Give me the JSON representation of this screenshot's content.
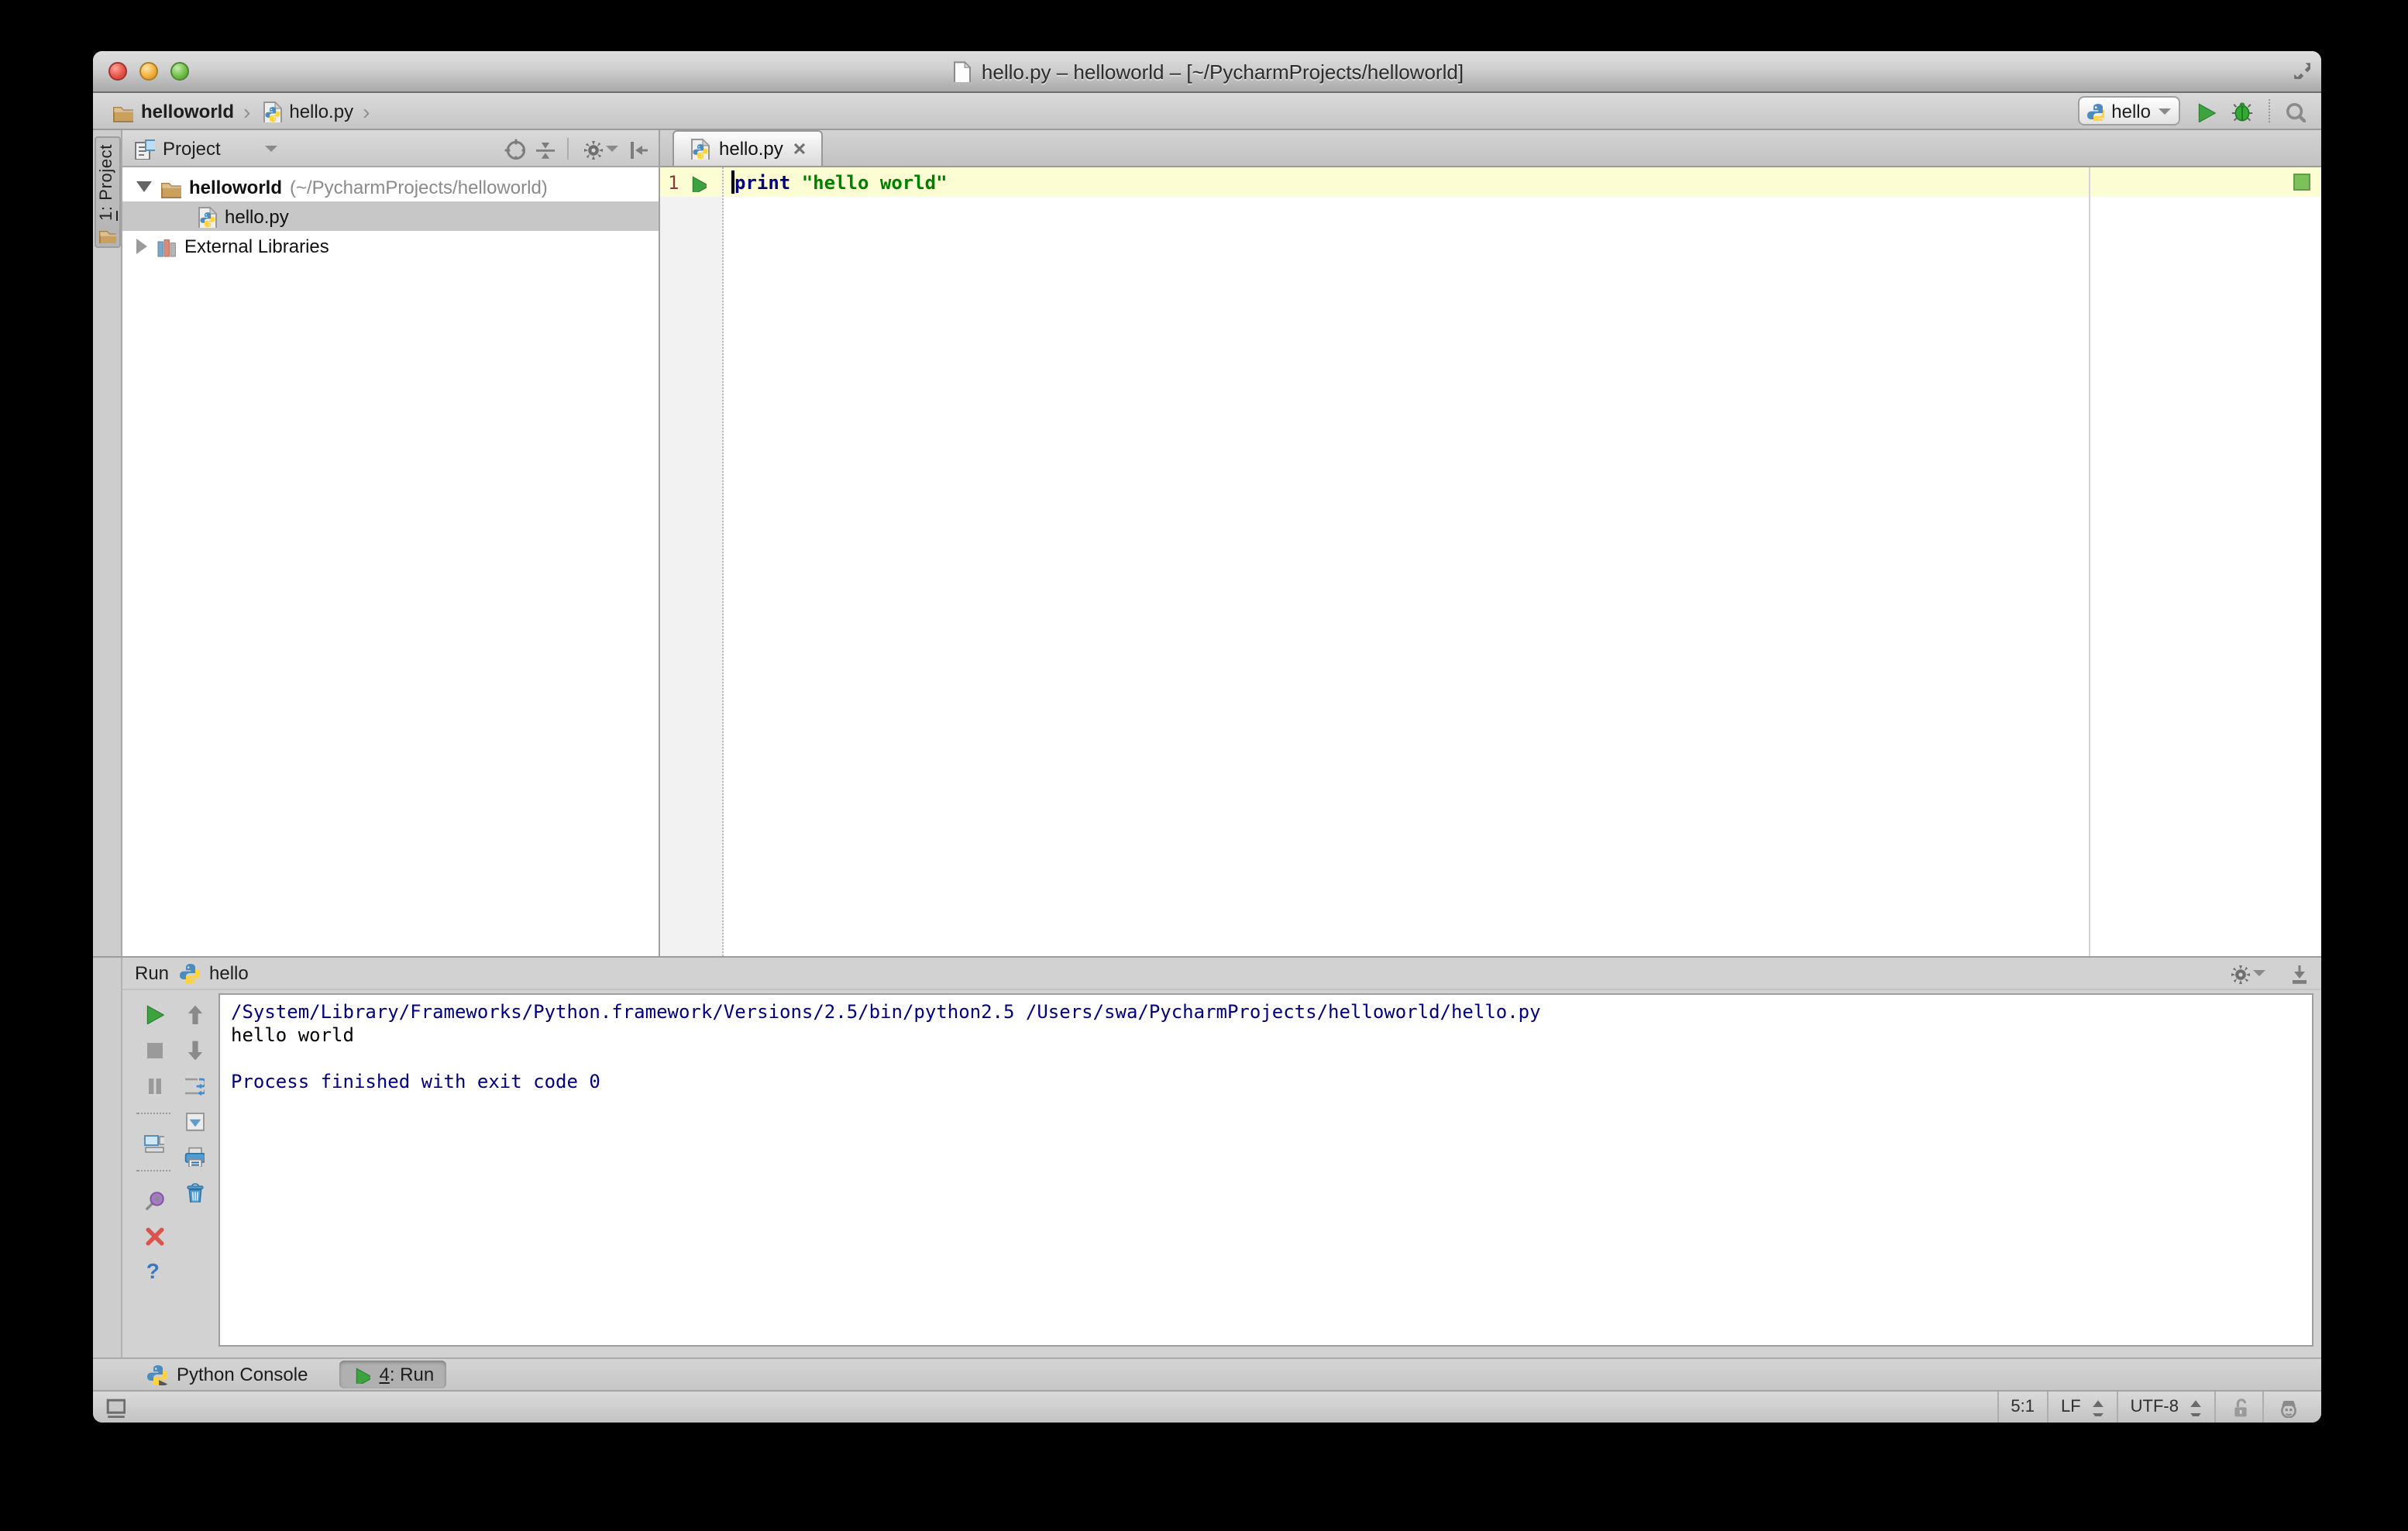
{
  "window": {
    "title": "hello.py – helloworld – [~/PycharmProjects/helloworld]"
  },
  "navbar": {
    "breadcrumbs": [
      "helloworld",
      "hello.py"
    ],
    "separator": "›",
    "run_config": {
      "label": "hello"
    }
  },
  "left_stripe": {
    "project_button": {
      "mnemonic": "1",
      "rest": ": Project"
    }
  },
  "project_panel": {
    "title": "Project",
    "tree": {
      "root_name": "helloworld",
      "root_path": "(~/PycharmProjects/helloworld)",
      "file": "hello.py",
      "external_libraries": "External Libraries"
    }
  },
  "editor": {
    "tab": {
      "label": "hello.py",
      "close_glyph": "✕"
    },
    "gutter": {
      "line_number": "1"
    },
    "code": {
      "keyword": "print",
      "string": "\"hello world\""
    }
  },
  "run_panel": {
    "title": "Run",
    "config_name": "hello",
    "help_glyph": "?",
    "console": {
      "command_line": "/System/Library/Frameworks/Python.framework/Versions/2.5/bin/python2.5 /Users/swa/PycharmProjects/helloworld/hello.py",
      "stdout": "hello world",
      "exit_message": "Process finished with exit code 0"
    }
  },
  "bottom_bar": {
    "python_console": "Python Console",
    "run_tab": {
      "mnemonic": "4",
      "rest": ": Run"
    }
  },
  "status_bar": {
    "caret_position": "5:1",
    "line_separator": "LF",
    "encoding": "UTF-8"
  },
  "colors": {
    "keyword": "#000080",
    "string": "#008000",
    "console_system": "#000080",
    "current_line": "#FDFDD3",
    "run_green": "#3DA33F",
    "close_red": "#D9534F",
    "inspection_ok": "#7CC25A"
  }
}
